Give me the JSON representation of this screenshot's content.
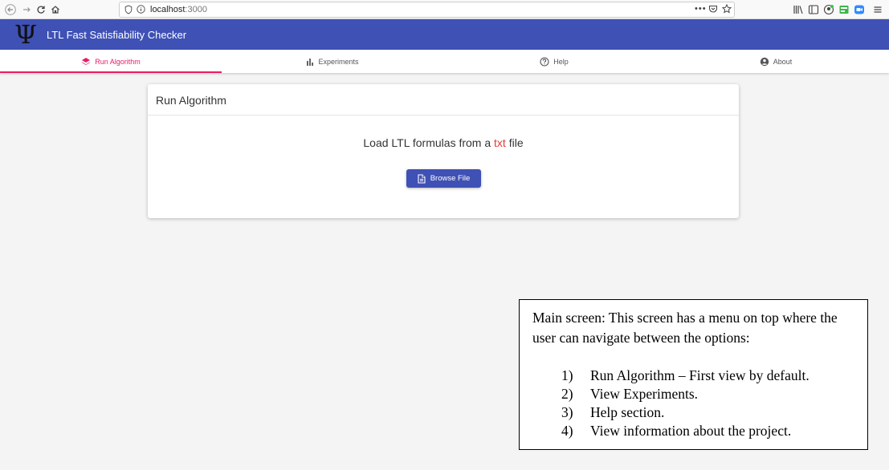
{
  "browser": {
    "url_host": "localhost",
    "url_port": ":3000",
    "icons": [
      "back-icon",
      "forward-icon",
      "reload-icon",
      "home-icon",
      "shield-icon",
      "info-icon",
      "more-icon",
      "pocket-icon",
      "bookmark-star-icon",
      "library-icon",
      "sidebar-icon",
      "account-icon",
      "extension-icon",
      "zoom-icon",
      "menu-icon"
    ]
  },
  "header": {
    "logo": "Ψ",
    "title": "LTL Fast Satisfiability Checker",
    "color": "#3f51b5"
  },
  "tabs": [
    {
      "label": "Run Algorithm",
      "icon": "layers-icon",
      "active": true
    },
    {
      "label": "Experiments",
      "icon": "bar-chart-icon",
      "active": false
    },
    {
      "label": "Help",
      "icon": "help-circle-icon",
      "active": false
    },
    {
      "label": "About",
      "icon": "account-circle-icon",
      "active": false
    }
  ],
  "accent_color": "#e91e63",
  "card": {
    "title": "Run Algorithm",
    "load_prefix": "Load LTL formulas from a ",
    "load_ext": "txt",
    "load_suffix": " file",
    "button_label": "Browse File",
    "button_icon": "file-icon"
  },
  "annotation": {
    "paragraph": "Main screen: This screen has a menu on top where the user can navigate between the options:",
    "items": [
      {
        "num": "1)",
        "text": "Run Algorithm – First view by default."
      },
      {
        "num": "2)",
        "text": "View Experiments."
      },
      {
        "num": "3)",
        "text": "Help section."
      },
      {
        "num": "4)",
        "text": "View information about the project."
      }
    ]
  }
}
